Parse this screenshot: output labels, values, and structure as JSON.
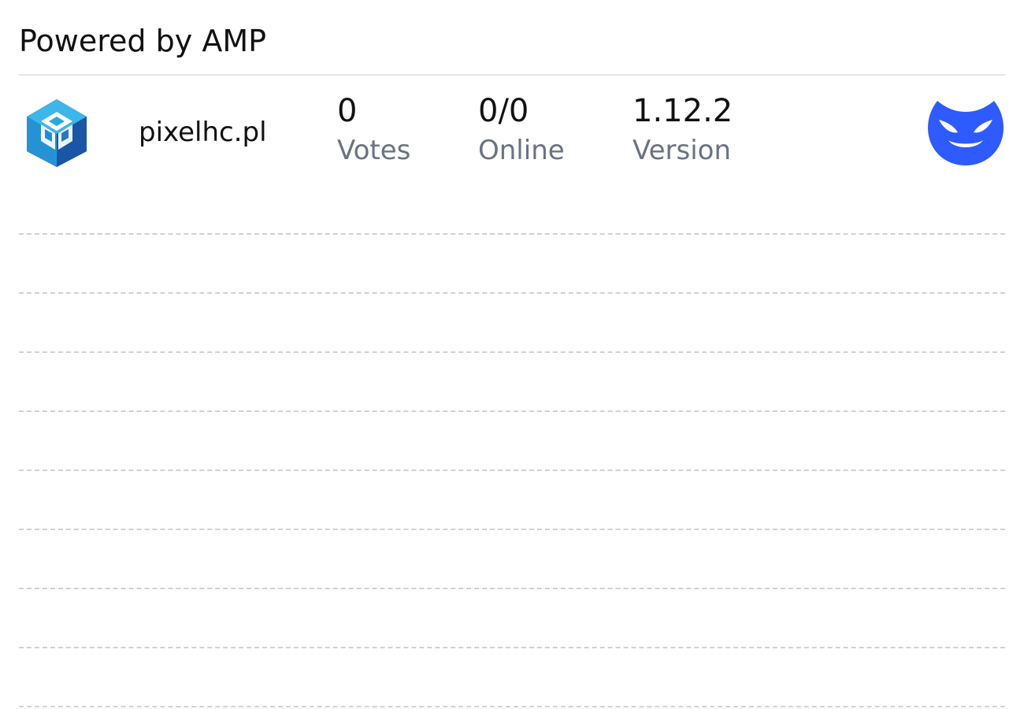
{
  "header": {
    "title": "Powered by AMP"
  },
  "server": {
    "name": "pixelhc.pl",
    "logo_icon": "pixelhc-cube-logo-icon",
    "stats": [
      {
        "value": "0",
        "label": "Votes"
      },
      {
        "value": "0/0",
        "label": "Online"
      },
      {
        "value": "1.12.2",
        "label": "Version"
      }
    ],
    "action_icon": "devil-face-icon"
  },
  "colors": {
    "accent": "#2e5bff",
    "logo_light": "#29a8e0",
    "logo_dark": "#1f63b5",
    "label_gray": "#6b7280",
    "divider": "#e3e6ea",
    "dashed_line": "#cfd2d6"
  }
}
